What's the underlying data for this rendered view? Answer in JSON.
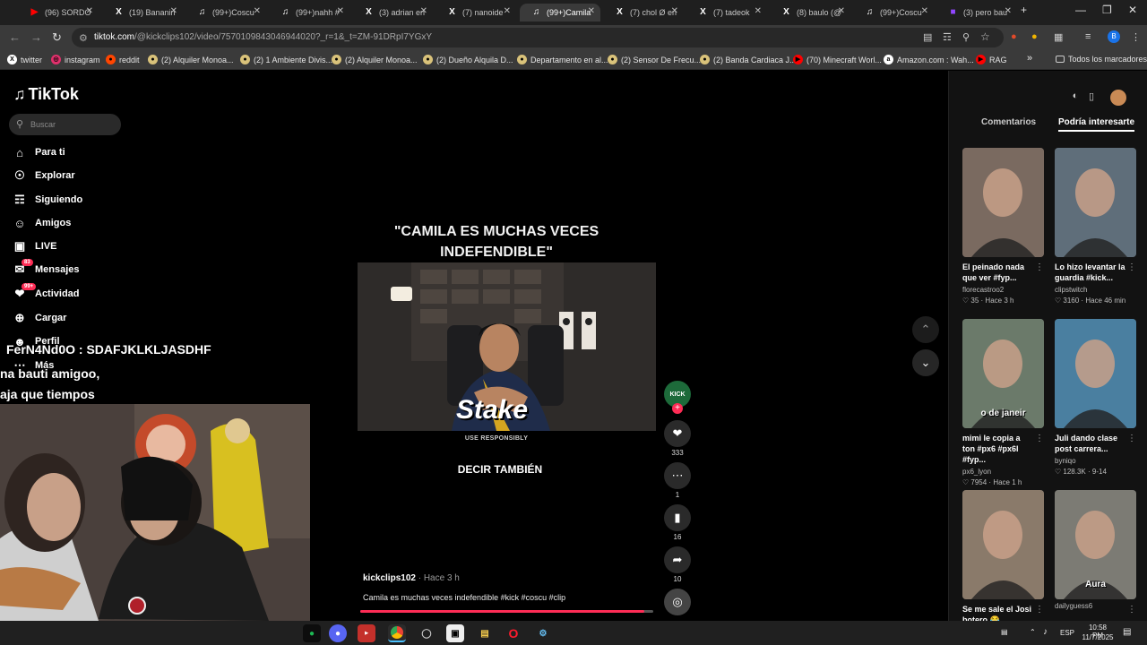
{
  "browser": {
    "tabs": [
      {
        "title": "(96) SORDO",
        "icon": "youtube-icon",
        "color": "#ff0000"
      },
      {
        "title": "(19) Bananin",
        "icon": "x-icon",
        "color": "#ffffff"
      },
      {
        "title": "(99+)Coscu",
        "icon": "tiktok-icon",
        "color": "#ffffff"
      },
      {
        "title": "(99+)nahh #",
        "icon": "tiktok-icon",
        "color": "#ffffff"
      },
      {
        "title": "(3) adrian en",
        "icon": "x-icon",
        "color": "#ffffff"
      },
      {
        "title": "(7) nanoide",
        "icon": "x-icon",
        "color": "#ffffff"
      },
      {
        "title": "(99+)Camila",
        "icon": "tiktok-icon",
        "color": "#ffffff"
      },
      {
        "title": "(7) chol Ø en",
        "icon": "x-icon",
        "color": "#ffffff"
      },
      {
        "title": "(7) tadeok",
        "icon": "x-icon",
        "color": "#ffffff"
      },
      {
        "title": "(8) baulo (@",
        "icon": "x-icon",
        "color": "#ffffff"
      },
      {
        "title": "(99+)Coscu",
        "icon": "tiktok-icon",
        "color": "#ffffff"
      },
      {
        "title": "(3) pero bau",
        "icon": "twitch-icon",
        "color": "#9146ff"
      }
    ],
    "url_host": "tiktok.com",
    "url_path": "/@kickclips102/video/7570109843046944020?_r=1&_t=ZM-91DRpI7YGxY",
    "bookmarks": [
      {
        "label": "twitter",
        "icon": "x-icon",
        "color": "#ffffff"
      },
      {
        "label": "instagram",
        "icon": "instagram-icon",
        "color": "#e1306c"
      },
      {
        "label": "reddit",
        "icon": "reddit-icon",
        "color": "#ff4500"
      },
      {
        "label": "(2) Alquiler Monoa...",
        "icon": "bookmark-icon",
        "color": "#d9c27a"
      },
      {
        "label": "(2) 1 Ambiente Divis...",
        "icon": "bookmark-icon",
        "color": "#d9c27a"
      },
      {
        "label": "(2) Alquiler Monoa...",
        "icon": "bookmark-icon",
        "color": "#d9c27a"
      },
      {
        "label": "(2) Dueño Alquila D...",
        "icon": "bookmark-icon",
        "color": "#d9c27a"
      },
      {
        "label": "Departamento en al...",
        "icon": "bookmark-icon",
        "color": "#d9c27a"
      },
      {
        "label": "(2) Sensor De Frecu...",
        "icon": "bookmark-icon",
        "color": "#d9c27a"
      },
      {
        "label": "(2) Banda Cardiaca J...",
        "icon": "bookmark-icon",
        "color": "#d9c27a"
      },
      {
        "label": "(70) Minecraft Worl...",
        "icon": "youtube-icon",
        "color": "#ff0000"
      },
      {
        "label": "Amazon.com : Wah...",
        "icon": "amazon-icon",
        "color": "#ffffff"
      },
      {
        "label": "RAG",
        "icon": "youtube-icon",
        "color": "#ff0000"
      }
    ],
    "all_bookmarks": "Todos los marcadores"
  },
  "tiktok": {
    "logo": "TikTok",
    "search_placeholder": "Buscar",
    "nav": [
      {
        "label": "Para ti",
        "icon": "home-icon"
      },
      {
        "label": "Explorar",
        "icon": "compass-icon"
      },
      {
        "label": "Siguiendo",
        "icon": "following-icon"
      },
      {
        "label": "Amigos",
        "icon": "friends-icon"
      },
      {
        "label": "LIVE",
        "icon": "live-icon"
      },
      {
        "label": "Mensajes",
        "icon": "messages-icon",
        "badge": "83"
      },
      {
        "label": "Actividad",
        "icon": "activity-icon",
        "badge": "99+"
      },
      {
        "label": "Cargar",
        "icon": "upload-icon"
      },
      {
        "label": "Perfil",
        "icon": "profile-icon"
      },
      {
        "label": "Más",
        "icon": "more-icon"
      }
    ],
    "overlay_chat": [
      "FerN4Nd0O : SDAFJKLKLJASDHF",
      "na bauti amigoo,",
      "aja que tiempos"
    ],
    "video": {
      "title": "\"CAMILA ES MUCHAS VECES INDEFENDIBLE\"",
      "watermark": "Stake",
      "use_responsibly": "USE RESPONSIBLY",
      "caption": "DECIR TAMBIÉN",
      "author": "kickclips102",
      "time": "· Hace 3 h",
      "description": "Camila es muchas veces indefendible #kick #coscu #clip",
      "progress": 0.97,
      "likes": "333",
      "comments": "1",
      "saves": "16",
      "shares": "10"
    },
    "panel": {
      "tabs": [
        "Comentarios",
        "Podría interesarte"
      ],
      "active_tab": 1,
      "cards": [
        {
          "title": "El peinado nada que ver #fyp...",
          "user": "florecastroo2",
          "likes": "35",
          "age": "Hace 3 h",
          "overlay": "",
          "bg": "#7a6a60"
        },
        {
          "title": "Lo hizo levantar la guardia #kick...",
          "user": "clipstwitch",
          "likes": "3160",
          "age": "Hace 46 min",
          "overlay": "",
          "bg": "#5f6e7a"
        },
        {
          "title": "mimi le copia a ton #px6 #px6l #fyp...",
          "user": "px6_lyon",
          "likes": "7954",
          "age": "Hace 1 h",
          "overlay": "o de janeir",
          "bg": "#6b7a6a"
        },
        {
          "title": "Juli dando clase post carrera...",
          "user": "byniqo",
          "likes": "128.3K",
          "age": "9-14",
          "overlay": "",
          "bg": "#4a7fa0"
        },
        {
          "title": "Se me sale el Josi botero 😂",
          "user": "",
          "likes": "",
          "age": "",
          "overlay": "",
          "bg": "#8a7a6a"
        },
        {
          "title": "",
          "user": "dailyguess6",
          "likes": "",
          "age": "",
          "overlay": "Aura",
          "bg": "#7c7b74"
        }
      ]
    }
  },
  "taskbar": {
    "lang": "ESP",
    "time": "10:58 PM",
    "date": "11/7/2025"
  }
}
